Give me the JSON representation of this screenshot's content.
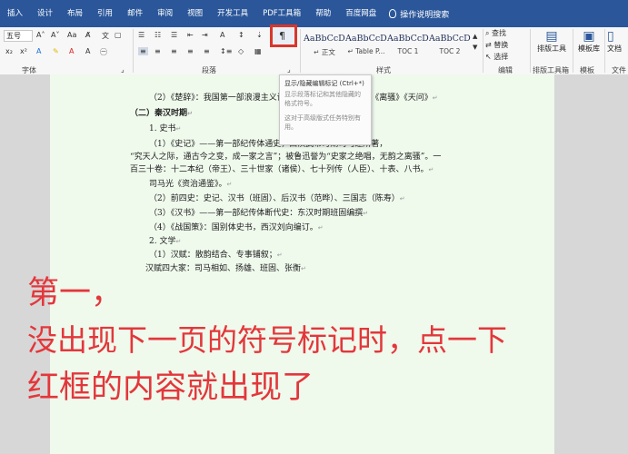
{
  "menu": {
    "items": [
      "插入",
      "设计",
      "布局",
      "引用",
      "邮件",
      "审阅",
      "视图",
      "开发工具",
      "PDF工具箱",
      "帮助",
      "百度网盘"
    ],
    "search_label": "操作说明搜索"
  },
  "ribbon": {
    "font": {
      "name": "五号",
      "group_label": "字体"
    },
    "paragraph": {
      "group_label": "段落"
    },
    "pilcrow_icon": "show-hide-marks-icon",
    "styles": {
      "group_label": "样式",
      "items": [
        {
          "preview": "AaBbCcDc",
          "name": "↵ 正文"
        },
        {
          "preview": "AaBbCcDc",
          "name": "↵ Table P..."
        },
        {
          "preview": "AaBbCcDd",
          "name": "TOC 1"
        },
        {
          "preview": "AaBbCcDd",
          "name": "TOC 2"
        }
      ]
    },
    "editing": {
      "group_label": "编辑",
      "find": "查找",
      "replace": "替换",
      "select": "选择"
    },
    "layout_tool": {
      "label": "排版工具",
      "group_label": "排版工具箱"
    },
    "template": {
      "label": "模板库",
      "group_label": "模板"
    },
    "doc": {
      "label": "文档",
      "group_label": "文件"
    }
  },
  "tooltip": {
    "title": "显示/隐藏编辑标记 (Ctrl+*)",
    "body": "显示段落标记和其他隐藏的格式符号。",
    "note": "这对于高级版式任务特别有用。"
  },
  "document": {
    "lines": [
      {
        "text": "（2）《楚辞》：我国第一部浪漫主义诗歌总集，主要作者屈原，《离骚》《天问》",
        "bold": false
      },
      {
        "text": "（二）秦汉时期",
        "bold": true
      },
      {
        "text": "1. 史书",
        "bold": false
      },
      {
        "text": "（1）《史记》——第一部纪传体通史，西汉武帝时期司马迁所著，",
        "bold": false
      },
      {
        "text": "“究天人之际，通古今之变，成一家之言”；被鲁迅誉为“史家之绝唱，无韵之离骚”。一",
        "bold": false
      },
      {
        "text": "百三十卷：十二本纪（帝王）、三十世家（诸侯）、七十列传（人臣）、十表、八书。",
        "bold": false
      },
      {
        "text": "司马光《资治通鉴》。",
        "bold": false
      },
      {
        "text": "（2）前四史：史记、汉书（班固）、后汉书（范晔）、三国志（陈寿）",
        "bold": false
      },
      {
        "text": "（3）《汉书》——第一部纪传体断代史：东汉时期班固编撰",
        "bold": false
      },
      {
        "text": "（4）《战国策》：国别体史书，西汉刘向编订。",
        "bold": false
      },
      {
        "text": "2. 文学",
        "bold": false
      },
      {
        "text": "（1）汉赋：散韵结合、专事铺叙；",
        "bold": false
      },
      {
        "text": "汉赋四大家：司马相如、扬雄、班固、张衡",
        "bold": false
      }
    ]
  },
  "overlay": {
    "line1": "第一，",
    "line2": "没出现下一页的符号标记时，点一下",
    "line3": "红框的内容就出现了"
  },
  "colors": {
    "ribbon_blue": "#2b579a",
    "highlight_red": "#d9362b",
    "overlay_red": "#e3373b",
    "page_green": "#eff9ec"
  }
}
